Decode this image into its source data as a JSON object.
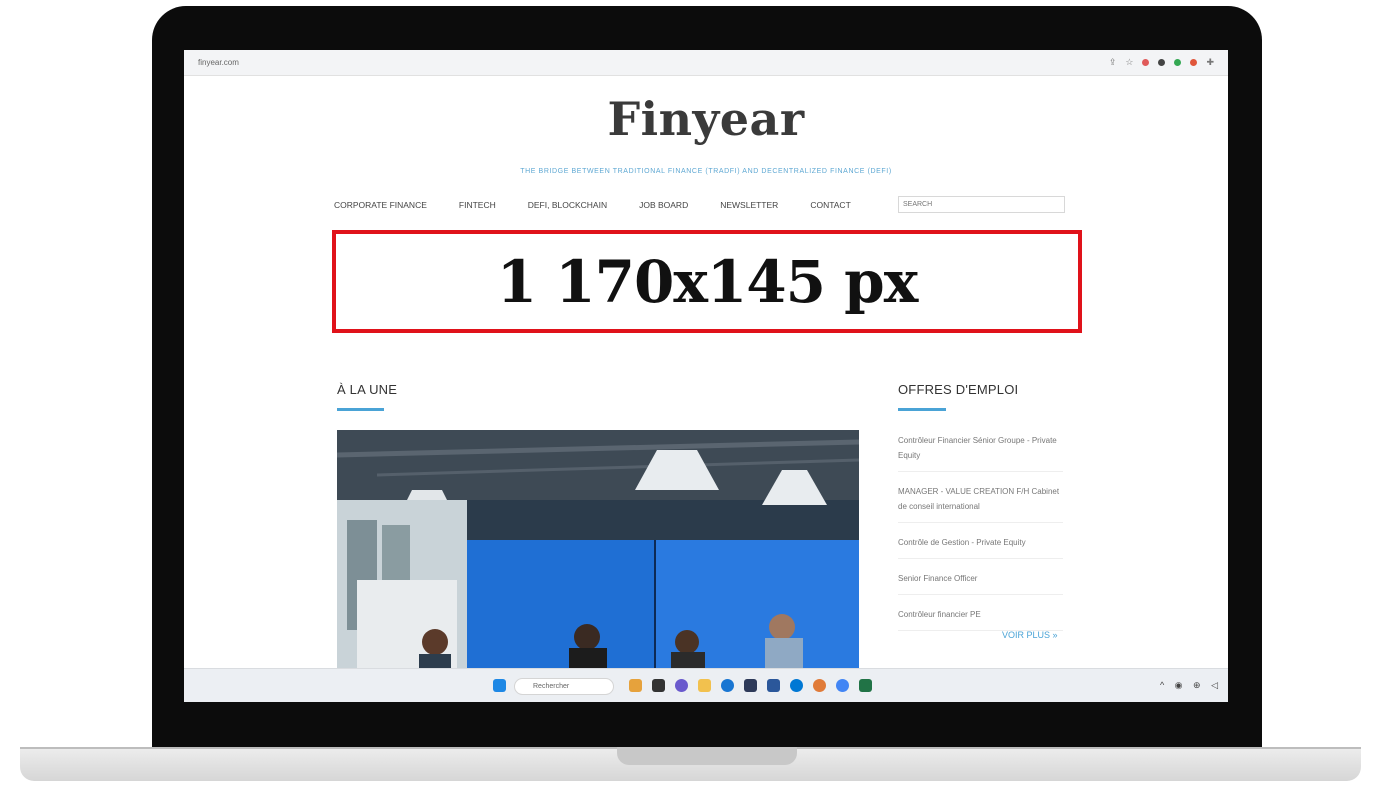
{
  "browser": {
    "url": "finyear.com"
  },
  "site": {
    "logo": "Finyear",
    "tagline": "THE BRIDGE BETWEEN TRADITIONAL FINANCE (TRADFI) AND DECENTRALIZED FINANCE (DEFI)",
    "nav": [
      "CORPORATE FINANCE",
      "FINTECH",
      "DEFI, BLOCKCHAIN",
      "JOB BOARD",
      "NEWSLETTER",
      "CONTACT"
    ],
    "search_placeholder": "SEARCH",
    "banner_text": "1 170x145 px",
    "headline_section": "À LA UNE",
    "jobs_section": "OFFRES D'EMPLOI",
    "jobs": [
      "Contrôleur Financier Sénior Groupe - Private Equity",
      "MANAGER - VALUE CREATION F/H Cabinet de conseil international",
      "Contrôle de Gestion - Private Equity",
      "Senior Finance Officer",
      "Contrôleur financier PE"
    ],
    "jobs_more": "VOIR PLUS »"
  },
  "taskbar": {
    "search_label": "Rechercher"
  },
  "colors": {
    "accent": "#4aa3d6",
    "banner_border": "#e0121a",
    "bezel": "#0c0c0c"
  }
}
